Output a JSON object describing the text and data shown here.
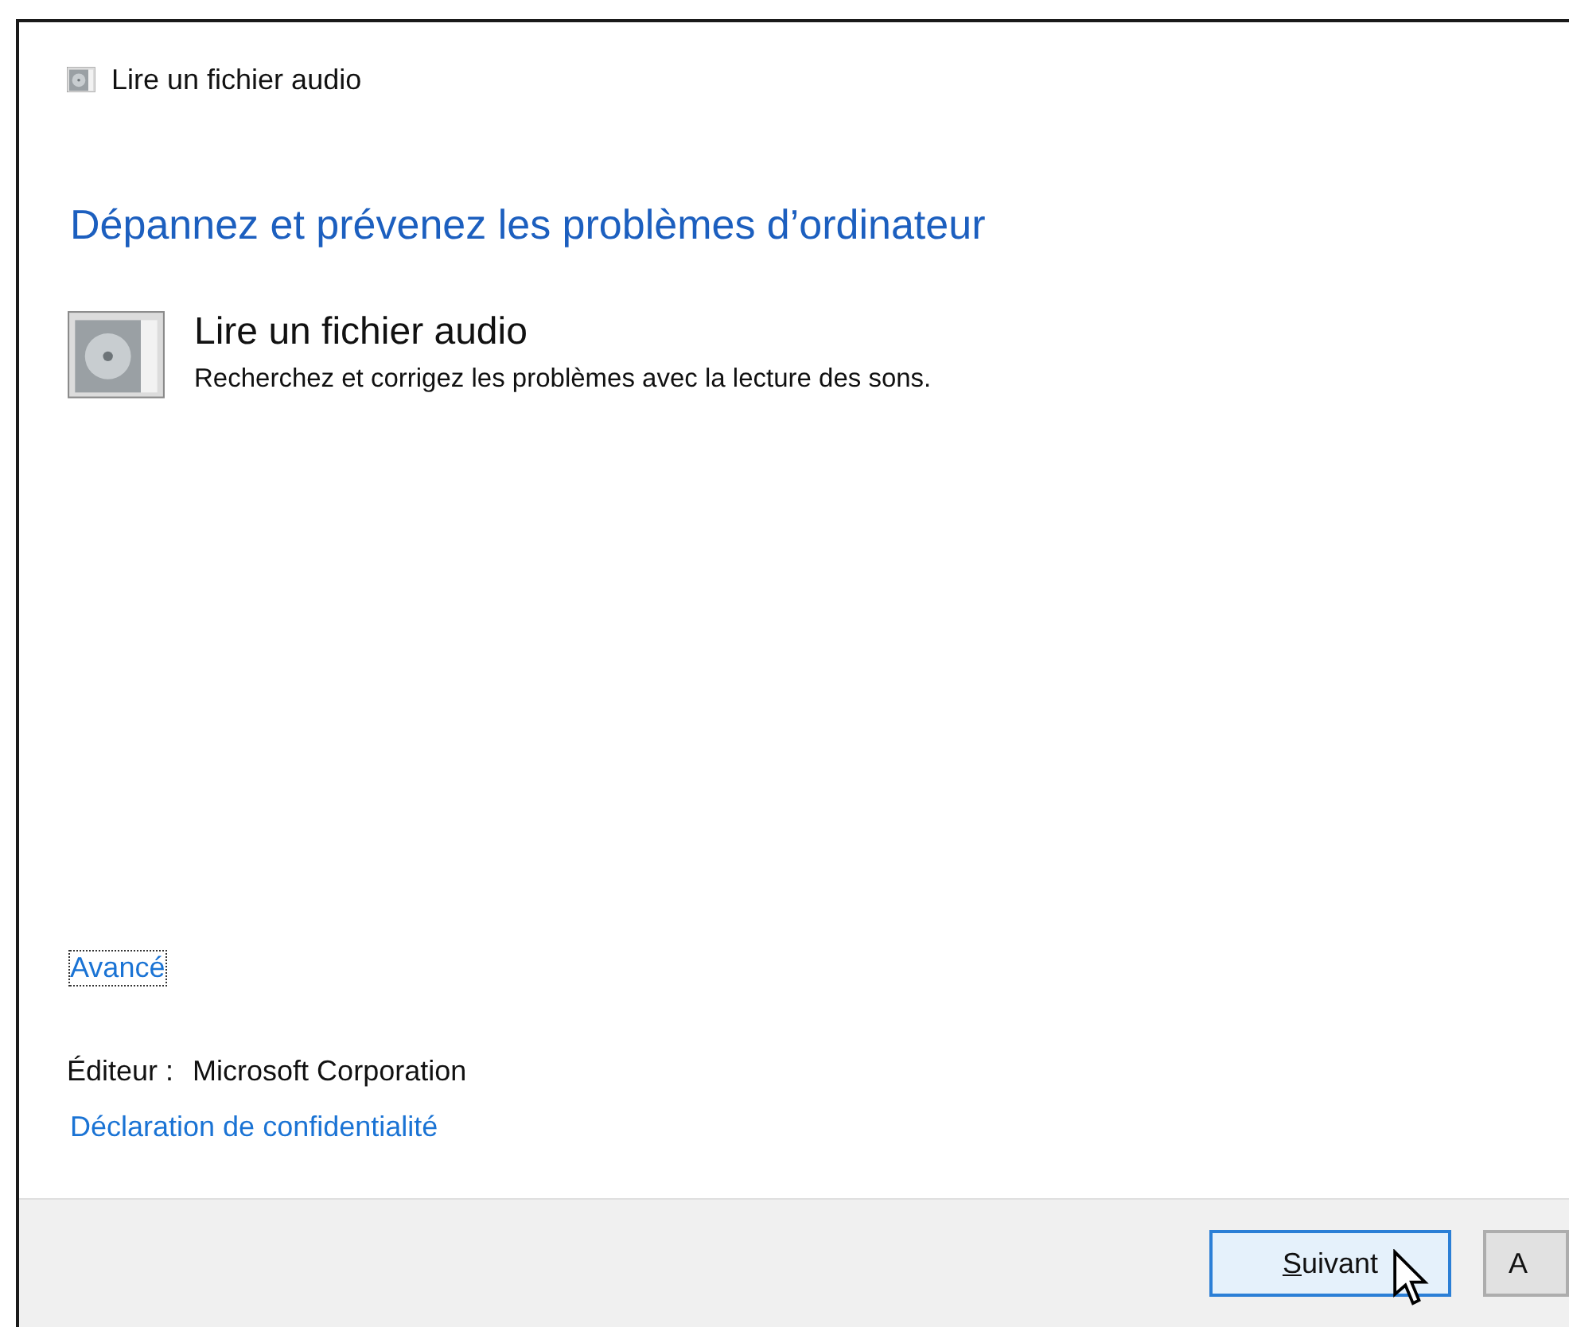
{
  "window": {
    "title": "Lire un fichier audio"
  },
  "heading": "Dépannez et prévenez les problèmes d’ordinateur",
  "troubleshooter": {
    "title": "Lire un fichier audio",
    "description": "Recherchez et corrigez les problèmes avec la lecture des sons."
  },
  "advanced_link": {
    "label": "Avancé",
    "focused": true
  },
  "publisher": {
    "label": "Éditeur :",
    "value": "Microsoft Corporation"
  },
  "privacy_link": "Déclaration de confidentialité",
  "buttons": [
    {
      "label": "Suivant",
      "default": true
    },
    {
      "label": "A",
      "default": false
    }
  ]
}
